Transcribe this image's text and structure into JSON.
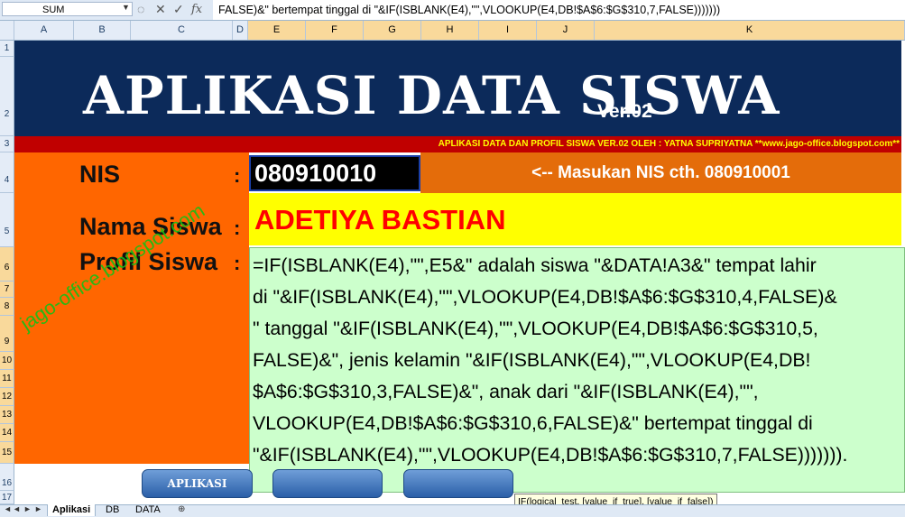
{
  "formula_bar": {
    "name_box": "SUM",
    "formula_text": "FALSE)&\" bertempat tinggal di \"&IF(ISBLANK(E4),\"\",VLOOKUP(E4,DB!$A$6:$G$310,7,FALSE)))))))",
    "icons": [
      "cancel-icon",
      "enter-icon",
      "function-icon"
    ],
    "function_glyph": "fx"
  },
  "columns": [
    "A",
    "B",
    "C",
    "D",
    "E",
    "F",
    "G",
    "H",
    "I",
    "J",
    "K"
  ],
  "rows": [
    "1",
    "2",
    "3",
    "4",
    "5",
    "6",
    "7",
    "8",
    "9",
    "10",
    "11",
    "12",
    "13",
    "14",
    "15",
    "16",
    "17"
  ],
  "sheet": {
    "title": "APLIKASI DATA SISWA",
    "version": "Ver.02",
    "credit": "APLIKASI DATA DAN PROFIL SISWA VER.02 OLEH : YATNA SUPRIYATNA **www.jago-office.blogspot.com**",
    "nis_label": "NIS",
    "nama_label": "Nama Siswa",
    "profil_label": "Profil Siswa",
    "colon": ":",
    "nis_value": "080910010",
    "hint": "<-- Masukan NIS cth. 080910001",
    "nama_value": "ADETIYA BASTIAN",
    "watermark": "jago-office.blogspot.com",
    "profil_formula_lines": [
      "=IF(ISBLANK(E4),\"\",E5&\" adalah siswa \"&DATA!A3&\" tempat lahir",
      "di \"&IF(ISBLANK(E4),\"\",VLOOKUP(E4,DB!$A$6:$G$310,4,FALSE)&",
      "\" tanggal \"&IF(ISBLANK(E4),\"\",VLOOKUP(E4,DB!$A$6:$G$310,5,",
      "FALSE)&\", jenis kelamin \"&IF(ISBLANK(E4),\"\",VLOOKUP(E4,DB!",
      "$A$6:$G$310,3,FALSE)&\", anak dari \"&IF(ISBLANK(E4),\"\",",
      "VLOOKUP(E4,DB!$A$6:$G$310,6,FALSE)&\" bertempat tinggal di",
      "\"&IF(ISBLANK(E4),\"\",VLOOKUP(E4,DB!$A$6:$G$310,7,FALSE)))))))."
    ],
    "button_aplikasi": "APLIKASI"
  },
  "tooltip": "IF(logical_test, [value_if_true], [value_if_false])",
  "tabs": [
    {
      "label": "Aplikasi",
      "active": true
    },
    {
      "label": "DB",
      "active": false
    },
    {
      "label": "DATA",
      "active": false
    }
  ],
  "colors": {
    "header_band": "#0c2a5a",
    "credit_band": "#c00000",
    "orange": "#ff6600",
    "name_fill": "#ffff00",
    "profil_fill": "#ccffcc",
    "ref_e4": "#1f3fd1",
    "ref_e5": "#0a9a3a"
  }
}
